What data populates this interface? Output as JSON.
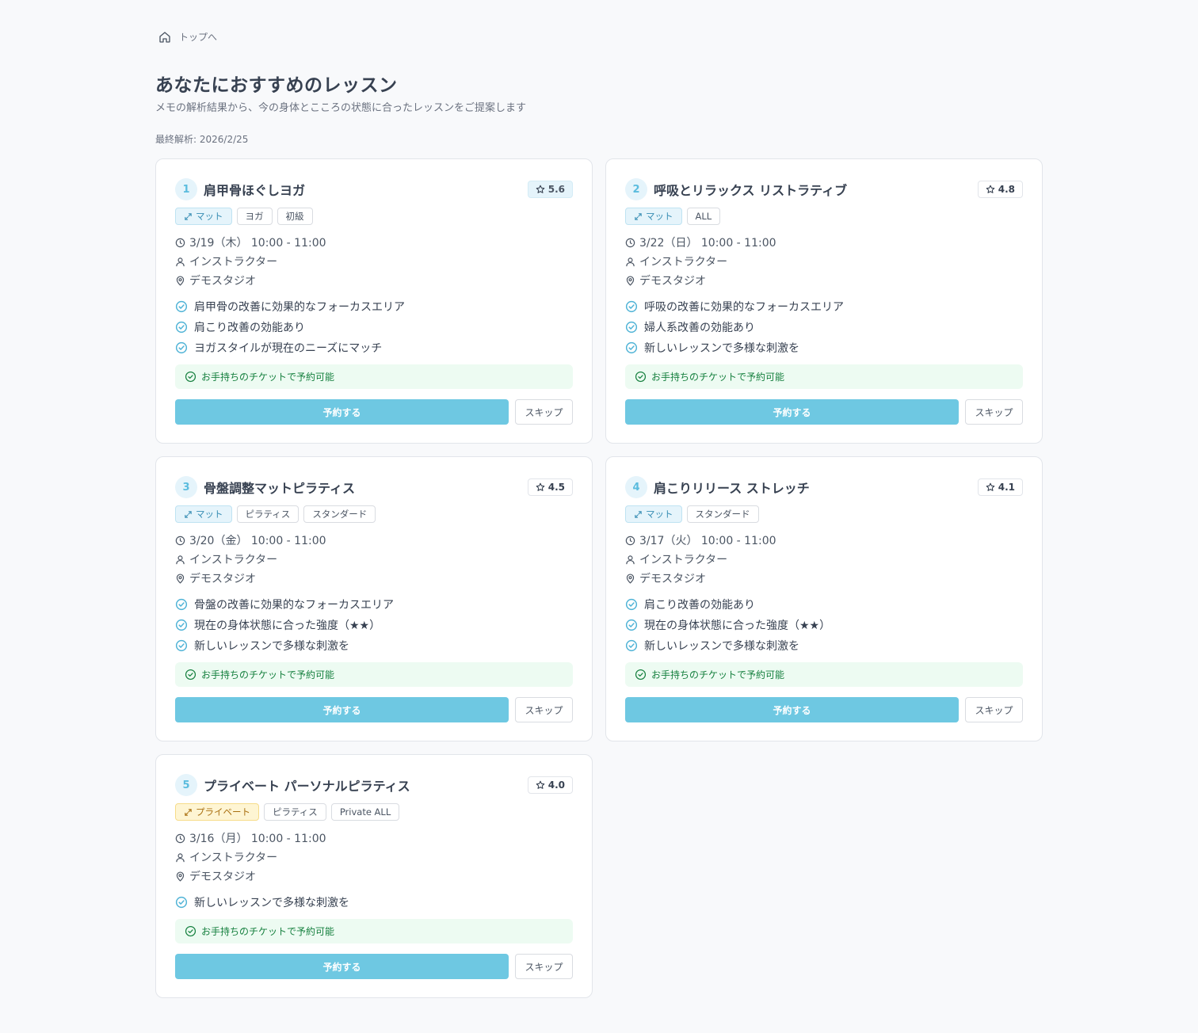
{
  "breadcrumb": {
    "label": "トップへ"
  },
  "header": {
    "title": "あなたにおすすめのレッスン",
    "subtitle": "メモの解析結果から、今の身体とこころの状態に合ったレッスンをご提案します",
    "last_analysis": "最終解析: 2026/2/25"
  },
  "colors": {
    "accent": "#6ec8e2",
    "rank_bg": "#e5f4fb",
    "ticket_bg": "#edfbf2",
    "ticket_text": "#16803f",
    "private_tag_bg": "#fef5d3"
  },
  "common": {
    "ticket_note": "お手持ちのチケットで予約可能",
    "reserve_label": "予約する",
    "skip_label": "スキップ"
  },
  "lessons": [
    {
      "rank": "1",
      "title": "肩甲骨ほぐしヨガ",
      "score": "5.6",
      "tags": [
        {
          "label": "マット",
          "kind": "mat"
        },
        {
          "label": "ヨガ",
          "kind": "plain"
        },
        {
          "label": "初級",
          "kind": "plain"
        }
      ],
      "datetime": "3/19（木） 10:00 - 11:00",
      "instructor": "インストラクター",
      "studio": "デモスタジオ",
      "reasons": [
        "肩甲骨の改善に効果的なフォーカスエリア",
        "肩こり改善の効能あり",
        "ヨガスタイルが現在のニーズにマッチ"
      ]
    },
    {
      "rank": "2",
      "title": "呼吸とリラックス リストラティブ",
      "score": "4.8",
      "tags": [
        {
          "label": "マット",
          "kind": "mat"
        },
        {
          "label": "ALL",
          "kind": "plain"
        }
      ],
      "datetime": "3/22（日） 10:00 - 11:00",
      "instructor": "インストラクター",
      "studio": "デモスタジオ",
      "reasons": [
        "呼吸の改善に効果的なフォーカスエリア",
        "婦人系改善の効能あり",
        "新しいレッスンで多様な刺激を"
      ]
    },
    {
      "rank": "3",
      "title": "骨盤調整マットピラティス",
      "score": "4.5",
      "tags": [
        {
          "label": "マット",
          "kind": "mat"
        },
        {
          "label": "ピラティス",
          "kind": "plain"
        },
        {
          "label": "スタンダード",
          "kind": "plain"
        }
      ],
      "datetime": "3/20（金） 10:00 - 11:00",
      "instructor": "インストラクター",
      "studio": "デモスタジオ",
      "reasons": [
        "骨盤の改善に効果的なフォーカスエリア",
        "現在の身体状態に合った強度（★★）",
        "新しいレッスンで多様な刺激を"
      ]
    },
    {
      "rank": "4",
      "title": "肩こりリリース ストレッチ",
      "score": "4.1",
      "tags": [
        {
          "label": "マット",
          "kind": "mat"
        },
        {
          "label": "スタンダード",
          "kind": "plain"
        }
      ],
      "datetime": "3/17（火） 10:00 - 11:00",
      "instructor": "インストラクター",
      "studio": "デモスタジオ",
      "reasons": [
        "肩こり改善の効能あり",
        "現在の身体状態に合った強度（★★）",
        "新しいレッスンで多様な刺激を"
      ]
    },
    {
      "rank": "5",
      "title": "プライベート パーソナルピラティス",
      "score": "4.0",
      "tags": [
        {
          "label": "プライベート",
          "kind": "private"
        },
        {
          "label": "ピラティス",
          "kind": "plain"
        },
        {
          "label": "Private ALL",
          "kind": "plain"
        }
      ],
      "datetime": "3/16（月） 10:00 - 11:00",
      "instructor": "インストラクター",
      "studio": "デモスタジオ",
      "reasons": [
        "新しいレッスンで多様な刺激を"
      ]
    }
  ]
}
